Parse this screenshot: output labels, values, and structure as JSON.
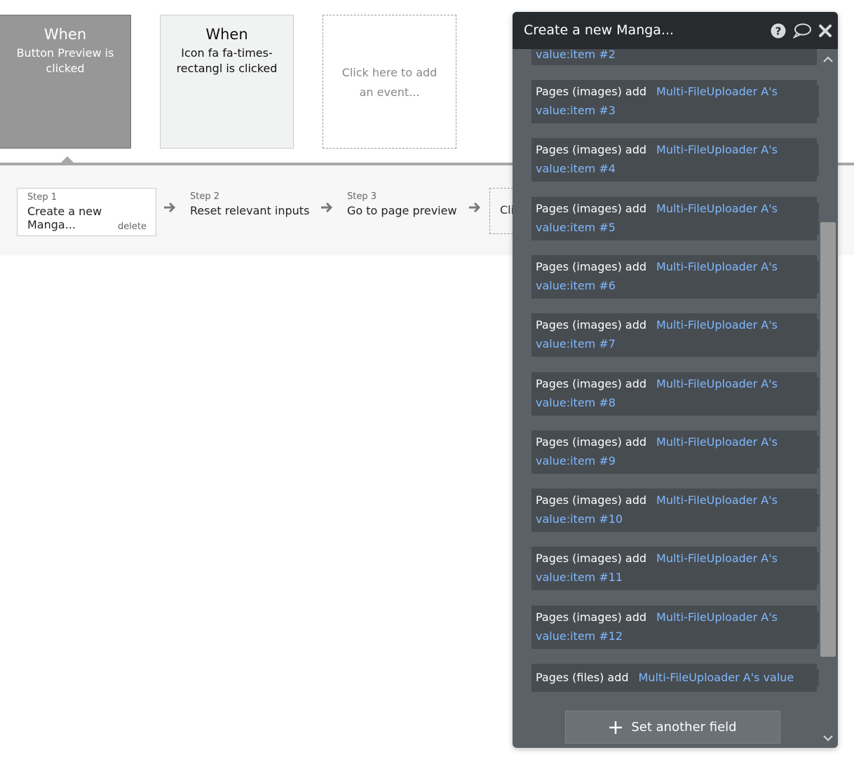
{
  "events": [
    {
      "when": "When",
      "desc": "Button Preview is clicked"
    },
    {
      "when": "When",
      "desc": "Icon fa fa-times-rectangl is clicked"
    }
  ],
  "add_event": "Click here to add an event...",
  "steps": [
    {
      "num": "Step 1",
      "name": "Create a new Manga...",
      "delete": "delete"
    },
    {
      "num": "Step 2",
      "name": "Reset relevant inputs"
    },
    {
      "num": "Step 3",
      "name": "Go to page preview"
    }
  ],
  "step_new_label": "Cli",
  "panel": {
    "title": "Create a new Manga...",
    "top_partial": "value:item #2",
    "rows": [
      {
        "field": "Pages (images) add",
        "value": "Multi-FileUploader A's value:item #3"
      },
      {
        "field": "Pages (images) add",
        "value": "Multi-FileUploader A's value:item #4"
      },
      {
        "field": "Pages (images) add",
        "value": "Multi-FileUploader A's value:item #5"
      },
      {
        "field": "Pages (images) add",
        "value": "Multi-FileUploader A's value:item #6"
      },
      {
        "field": "Pages (images) add",
        "value": "Multi-FileUploader A's value:item #7"
      },
      {
        "field": "Pages (images) add",
        "value": "Multi-FileUploader A's value:item #8"
      },
      {
        "field": "Pages (images) add",
        "value": "Multi-FileUploader A's value:item #9"
      },
      {
        "field": "Pages (images) add",
        "value": "Multi-FileUploader A's value:item #10"
      },
      {
        "field": "Pages (images) add",
        "value": "Multi-FileUploader A's value:item #11"
      },
      {
        "field": "Pages (images) add",
        "value": "Multi-FileUploader A's value:item #12"
      }
    ],
    "last_row": {
      "field": "Pages (files) add",
      "value": "Multi-FileUploader A's value"
    },
    "set_another": "Set another field"
  }
}
